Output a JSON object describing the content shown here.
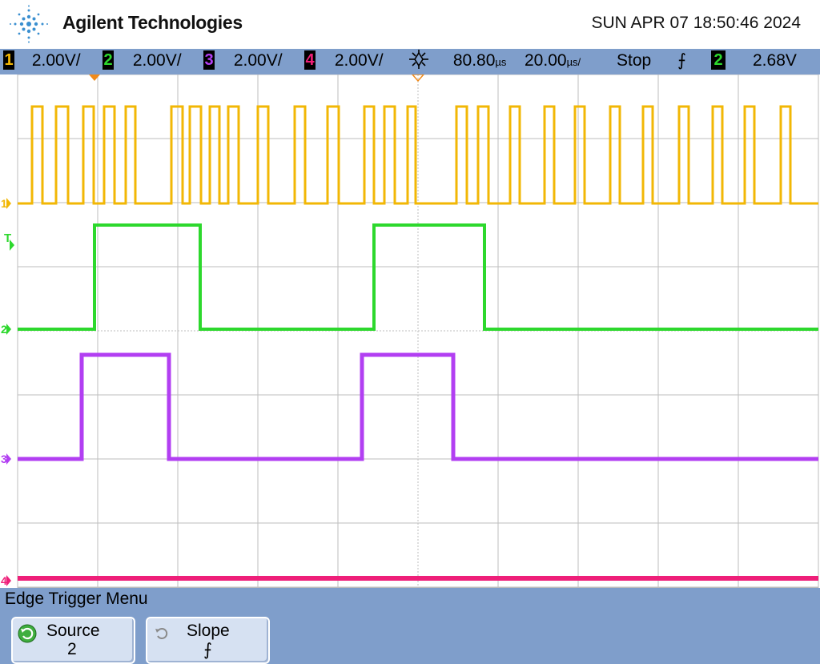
{
  "header": {
    "brand": "Agilent Technologies",
    "datetime": "SUN APR 07 18:50:46 2024"
  },
  "status": {
    "channels": [
      {
        "num": "1",
        "scale": "2.00V/",
        "color": "#f2b705"
      },
      {
        "num": "2",
        "scale": "2.00V/",
        "color": "#2dd82d"
      },
      {
        "num": "3",
        "scale": "2.00V/",
        "color": "#b23ff2"
      },
      {
        "num": "4",
        "scale": "2.00V/",
        "color": "#ee1f79"
      }
    ],
    "delay": "80.80",
    "delay_unit": "µs",
    "timebase": "20.00",
    "timebase_unit": "µs/",
    "run_state": "Stop",
    "trigger_slope_symbol": "⨍",
    "trigger_source": "2",
    "trigger_level": "2.68V"
  },
  "markers": {
    "ch1": "1",
    "ch2": "2",
    "ch3": "3",
    "ch4": "4",
    "trigger": "T"
  },
  "menu": {
    "title": "Edge Trigger Menu",
    "source_label": "Source",
    "source_value": "2",
    "slope_label": "Slope",
    "slope_value": "⨍"
  },
  "colors": {
    "ch1": "#f2b705",
    "ch2": "#2dd82d",
    "ch3": "#b23ff2",
    "ch4": "#ee1f79",
    "panel": "#7f9ecb",
    "grid": "#bdbdbd"
  }
}
